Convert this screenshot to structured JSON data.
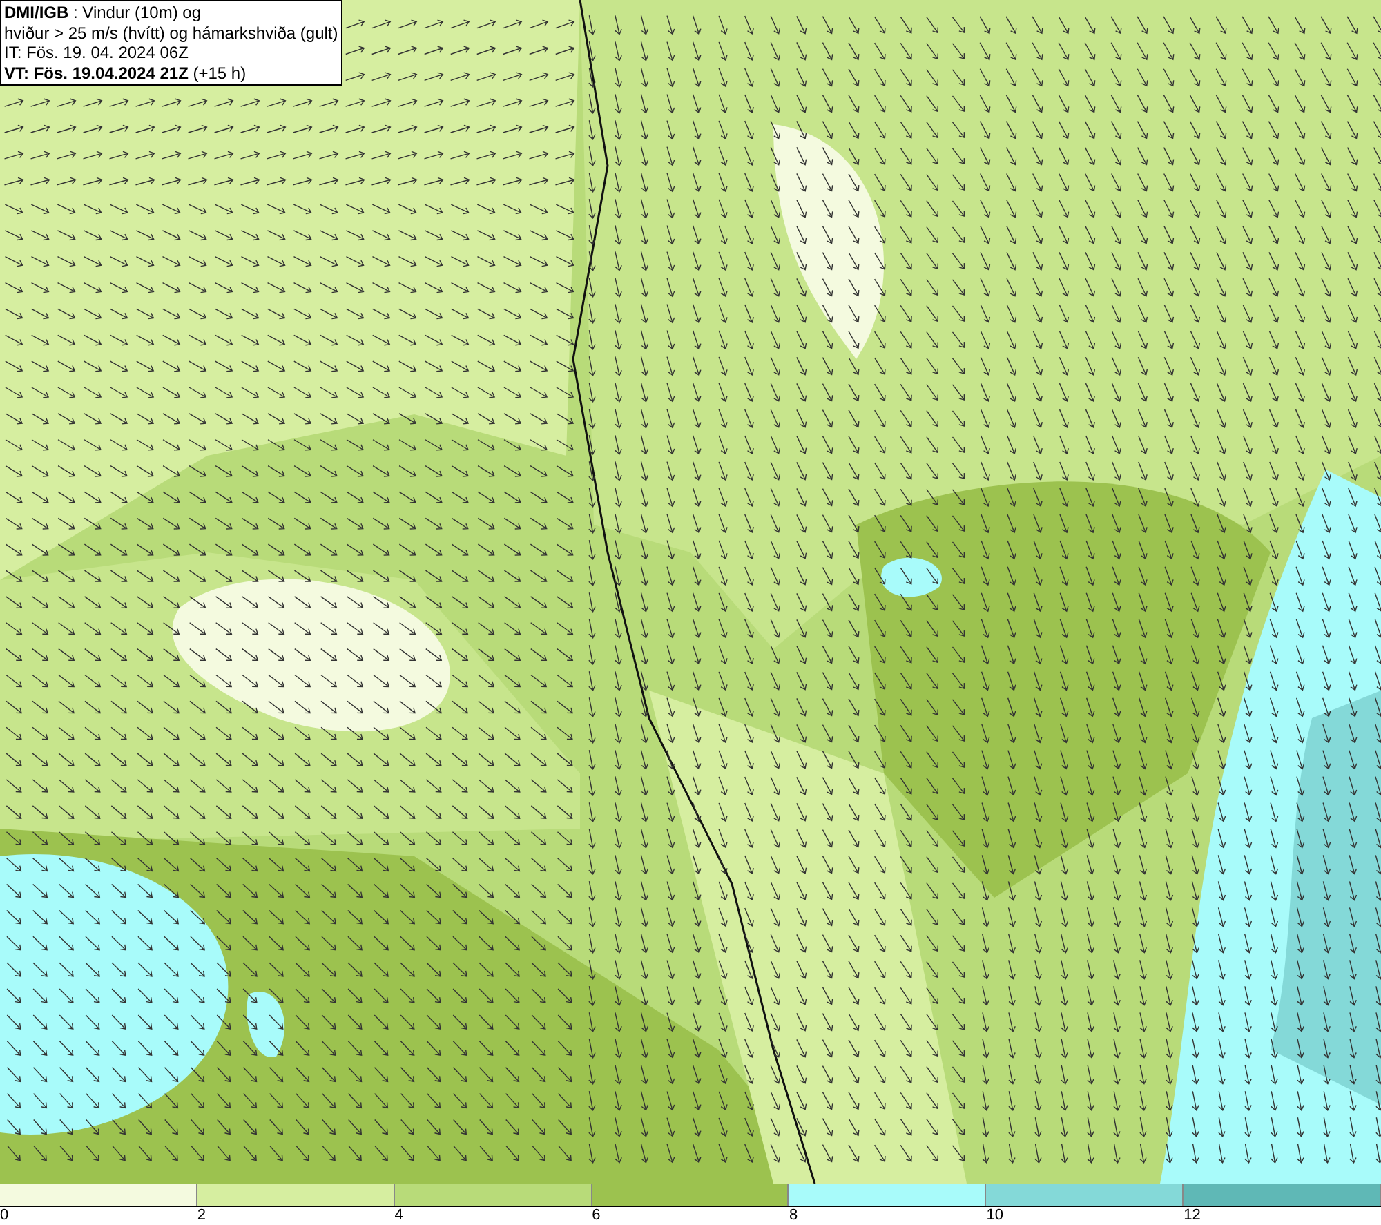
{
  "title_box": {
    "lines": [
      "**DMI/IGB** : Vindur (10m) og",
      "hviður > 25 m/s (hvítt) og hámarkshviða (gult)",
      "IT: Fös. 19. 04. 2024 06Z",
      "**VT: Fös. 19.04.2024 21Z** (+15 h)"
    ]
  },
  "legend": {
    "segments": [
      {
        "color": "#f4fadf"
      },
      {
        "color": "#d6eea0"
      },
      {
        "color": "#b8db79"
      },
      {
        "color": "#9cc24f"
      },
      {
        "color": "#a8fbfa"
      },
      {
        "color": "#84d9d8"
      },
      {
        "color": "#5fb8b6"
      }
    ],
    "ticks": [
      "0",
      "2",
      "4",
      "6",
      "8",
      "10",
      "12"
    ]
  }
}
